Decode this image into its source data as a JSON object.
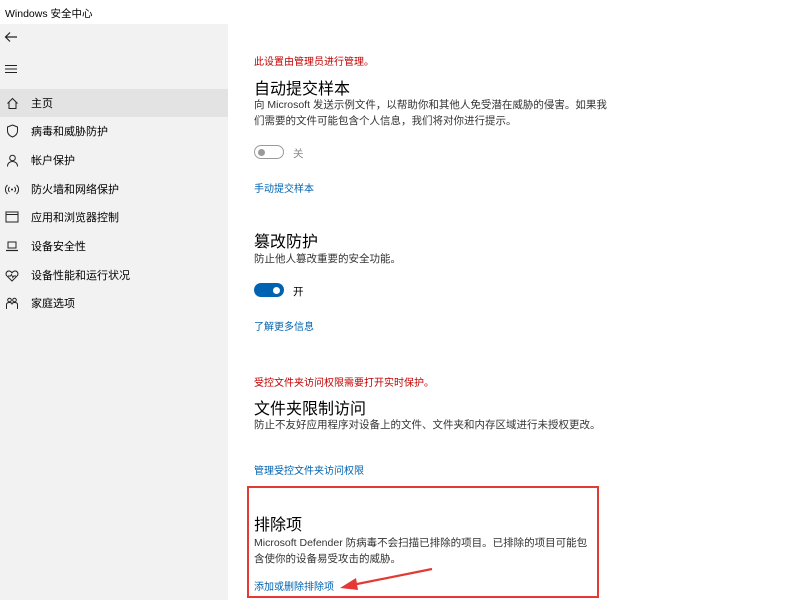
{
  "window": {
    "title": "Windows 安全中心"
  },
  "sidebar": {
    "back_icon": "back-arrow-icon",
    "menu_icon": "hamburger-icon",
    "items": [
      {
        "label": "主页",
        "icon": "home-icon",
        "selected": true
      },
      {
        "label": "病毒和威胁防护",
        "icon": "shield-icon",
        "selected": false
      },
      {
        "label": "帐户保护",
        "icon": "person-icon",
        "selected": false
      },
      {
        "label": "防火墙和网络保护",
        "icon": "wifi-signal-icon",
        "selected": false
      },
      {
        "label": "应用和浏览器控制",
        "icon": "browser-window-icon",
        "selected": false
      },
      {
        "label": "设备安全性",
        "icon": "laptop-icon",
        "selected": false
      },
      {
        "label": "设备性能和运行状况",
        "icon": "heart-icon",
        "selected": false
      },
      {
        "label": "家庭选项",
        "icon": "family-icon",
        "selected": false
      }
    ]
  },
  "sections": {
    "admin_warning": "此设置由管理员进行管理。",
    "sample_submission": {
      "title": "自动提交样本",
      "description": "向 Microsoft 发送示例文件，以帮助你和其他人免受潜在威胁的侵害。如果我们需要的文件可能包含个人信息，我们将对你进行提示。",
      "toggle_state": "关",
      "toggle_on": false,
      "link": "手动提交样本"
    },
    "tamper_protection": {
      "title": "篡改防护",
      "description": "防止他人篡改重要的安全功能。",
      "toggle_state": "开",
      "toggle_on": true,
      "link": "了解更多信息"
    },
    "folder_access_warning": "受控文件夹访问权限需要打开实时保护。",
    "controlled_folder_access": {
      "title": "文件夹限制访问",
      "description": "防止不友好应用程序对设备上的文件、文件夹和内存区域进行未授权更改。",
      "link": "管理受控文件夹访问权限"
    },
    "exclusions": {
      "title": "排除项",
      "description": "Microsoft Defender 防病毒不会扫描已排除的项目。已排除的项目可能包含使你的设备易受攻击的威胁。",
      "link": "添加或删除排除项"
    }
  },
  "colors": {
    "accent": "#0063b1",
    "warning_text": "#c00000",
    "annotation": "#e53935"
  }
}
